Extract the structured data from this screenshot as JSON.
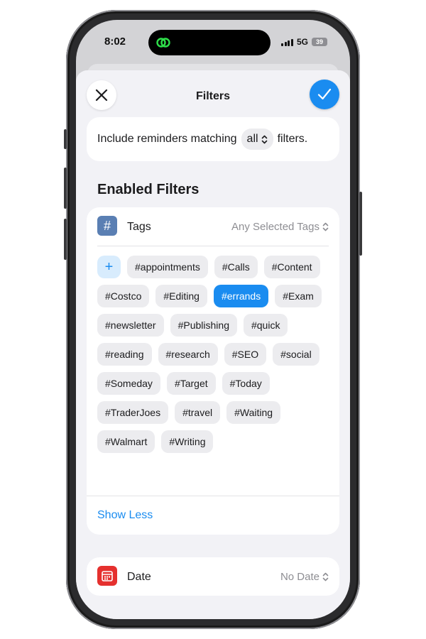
{
  "status": {
    "time": "8:02",
    "network": "5G",
    "battery": "39"
  },
  "header": {
    "title": "Filters"
  },
  "match": {
    "prefix": "Include reminders matching",
    "mode": "all",
    "suffix": "filters."
  },
  "section_title": "Enabled Filters",
  "tags_filter": {
    "icon_glyph": "#",
    "label": "Tags",
    "value": "Any Selected Tags",
    "add_glyph": "+",
    "tags": [
      {
        "label": "#appointments",
        "selected": false
      },
      {
        "label": "#Calls",
        "selected": false
      },
      {
        "label": "#Content",
        "selected": false
      },
      {
        "label": "#Costco",
        "selected": false
      },
      {
        "label": "#Editing",
        "selected": false
      },
      {
        "label": "#errands",
        "selected": true
      },
      {
        "label": "#Exam",
        "selected": false
      },
      {
        "label": "#newsletter",
        "selected": false
      },
      {
        "label": "#Publishing",
        "selected": false
      },
      {
        "label": "#quick",
        "selected": false
      },
      {
        "label": "#reading",
        "selected": false
      },
      {
        "label": "#research",
        "selected": false
      },
      {
        "label": "#SEO",
        "selected": false
      },
      {
        "label": "#social",
        "selected": false
      },
      {
        "label": "#Someday",
        "selected": false
      },
      {
        "label": "#Target",
        "selected": false
      },
      {
        "label": "#Today",
        "selected": false
      },
      {
        "label": "#TraderJoes",
        "selected": false
      },
      {
        "label": "#travel",
        "selected": false
      },
      {
        "label": "#Waiting",
        "selected": false
      },
      {
        "label": "#Walmart",
        "selected": false
      },
      {
        "label": "#Writing",
        "selected": false
      }
    ],
    "show_less": "Show Less"
  },
  "date_filter": {
    "label": "Date",
    "value": "No Date"
  },
  "icons": {
    "close": "close-icon",
    "done": "checkmark-icon",
    "tags": "hashtag-icon",
    "date": "calendar-icon",
    "chevrons": "chevron-up-down-icon",
    "island": "link-app-icon"
  },
  "colors": {
    "accent": "#1a8cf0",
    "tags_icon": "#5a7fb3",
    "date_icon": "#e5302e",
    "island_icon": "#2ee04a"
  }
}
